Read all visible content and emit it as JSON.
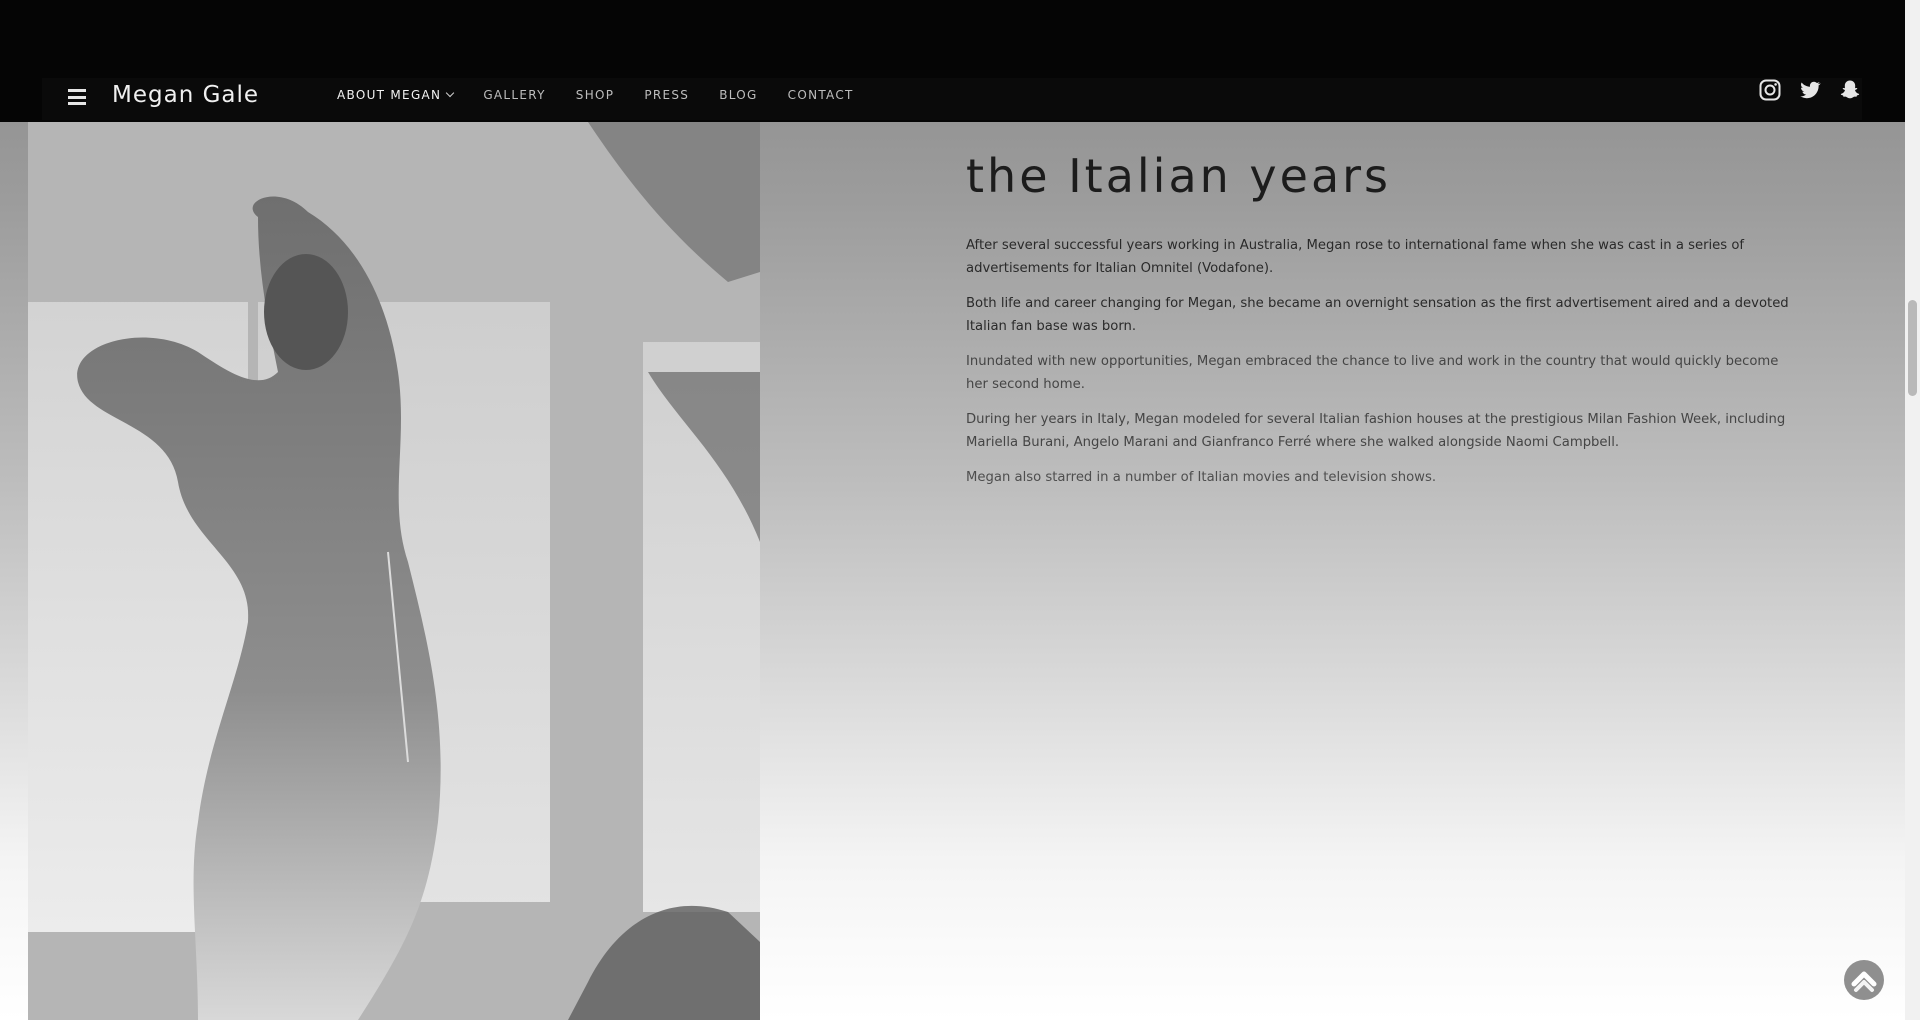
{
  "header": {
    "brand": "Megan Gale",
    "nav": [
      {
        "label": "ABOUT MEGAN",
        "active": true,
        "has_dropdown": true
      },
      {
        "label": "GALLERY",
        "active": false
      },
      {
        "label": "SHOP",
        "active": false
      },
      {
        "label": "PRESS",
        "active": false
      },
      {
        "label": "BLOG",
        "active": false
      },
      {
        "label": "CONTACT",
        "active": false
      }
    ],
    "social_icons": [
      "instagram-icon",
      "twitter-icon",
      "snapchat-icon"
    ]
  },
  "main": {
    "heading": "the Italian years",
    "paragraphs": [
      "After several successful years working in Australia, Megan rose to international fame when she was cast in a series of advertisements for Italian Omnitel (Vodafone).",
      "Both life and career changing for Megan, she became an overnight sensation as the first advertisement aired and a devoted Italian fan base was born.",
      "Inundated with new opportunities, Megan embraced the chance to live and work in the country that would quickly become her second home.",
      "During her years in Italy, Megan modeled for several Italian fashion houses at the prestigious Milan Fashion Week, including Mariella Burani, Angelo Marani and Gianfranco Ferré where she walked alongside Naomi Campbell.",
      "Megan also starred in a number of Italian movies and television shows."
    ]
  },
  "colors": {
    "top_band": "#050505",
    "nav_active": "#f2f2f2",
    "nav_inactive": "#bdbdbd",
    "text": "#2a2a2a"
  },
  "controls": {
    "back_to_top_icon": "chevron-up-icon",
    "menu_icon": "hamburger-menu-icon"
  }
}
